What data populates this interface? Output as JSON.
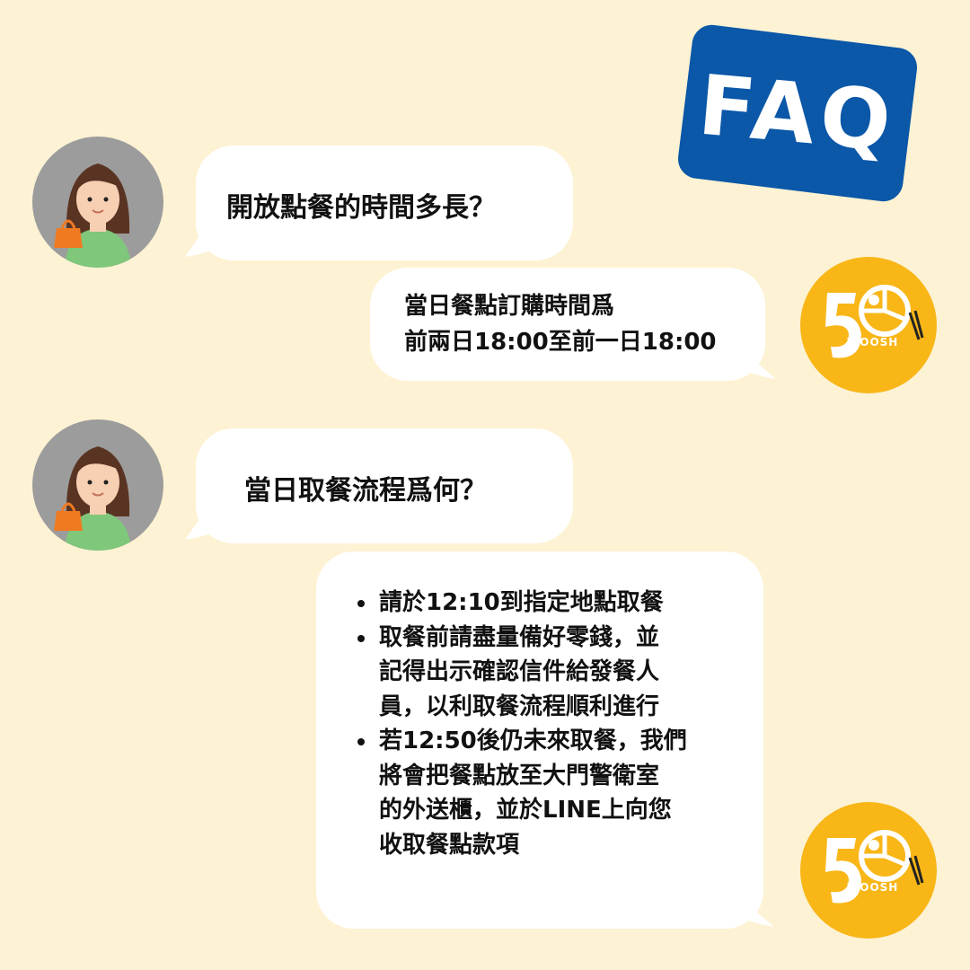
{
  "badge": {
    "label": "FAQ"
  },
  "colors": {
    "background": "#fdf2d3",
    "badge": "#0b57a8",
    "logo": "#f8b617",
    "avatar_bg": "#9c9c9c"
  },
  "logo": {
    "number": "50",
    "word": "WOOSH"
  },
  "faq": [
    {
      "question": "開放點餐的時間多長？",
      "answer_lines": [
        "當日餐點訂購時間爲",
        "前兩日18:00至前一日18:00"
      ]
    },
    {
      "question": "當日取餐流程爲何？",
      "answer_bullets": [
        {
          "lines": [
            "請於12:10到指定地點取餐"
          ]
        },
        {
          "lines": [
            "取餐前請盡量備好零錢，並",
            "記得出示確認信件給發餐人",
            "員，以利取餐流程順利進行"
          ]
        },
        {
          "lines": [
            "若12:50後仍未來取餐，我們",
            "將會把餐點放至大門警衛室",
            "的外送櫃，並於LINE上向您",
            "收取餐點款項"
          ]
        }
      ]
    }
  ]
}
